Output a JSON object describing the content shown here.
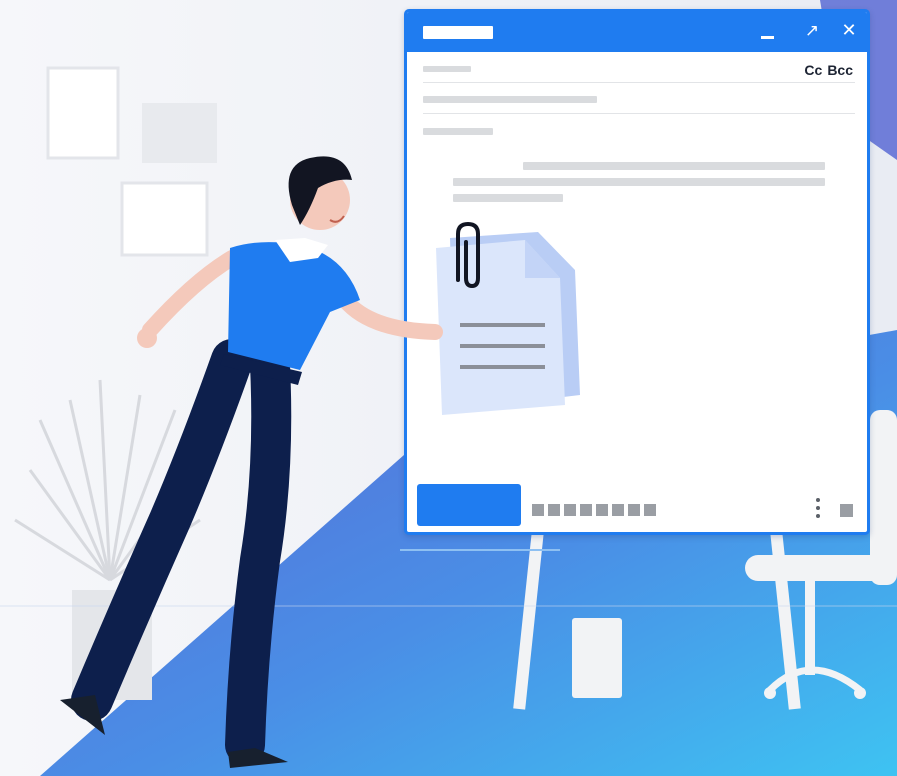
{
  "compose": {
    "cc_label": "Cc",
    "bcc_label": "Bcc"
  },
  "icons": {
    "minimize": "minimize-icon",
    "maximize": "expand-icon",
    "close": "close-icon",
    "attachment": "paperclip-icon",
    "more": "more-vertical-icon",
    "discard": "trash-icon"
  },
  "colors": {
    "accent": "#1f7cf0",
    "gradient_start": "#5b6fd6",
    "gradient_end": "#3db8f0"
  }
}
